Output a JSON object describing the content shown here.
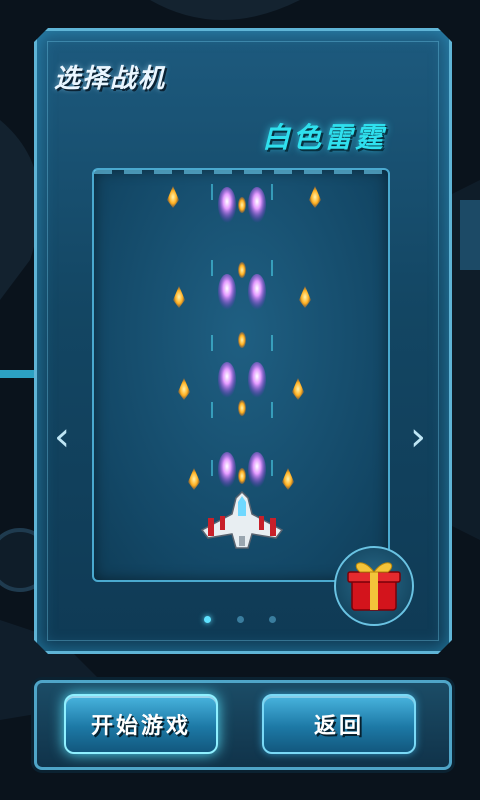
{
  "screen": {
    "title": "选择战机",
    "plane_name": "白色雷霆"
  },
  "buttons": {
    "start": "开始游戏",
    "back": "返回"
  },
  "carousel": {
    "pages": 3,
    "active_index": 0
  },
  "colors": {
    "accent": "#2fe0ee",
    "panel": "#134663",
    "button": "#1d79a6"
  }
}
